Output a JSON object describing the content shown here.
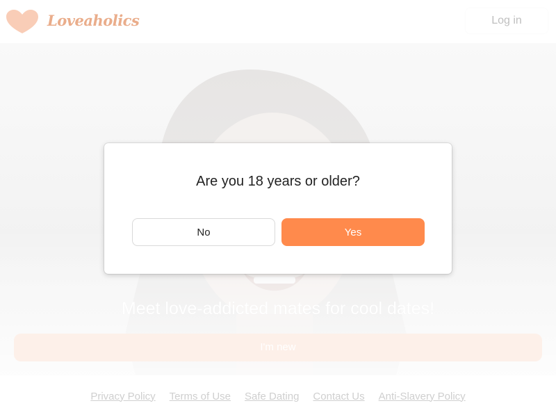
{
  "header": {
    "logo_text": "Loveaholics",
    "login_label": "Log in"
  },
  "hero": {
    "headline": "Meet love-addicted mates for cool dates!",
    "new_button_label": "I'm new"
  },
  "modal": {
    "question": "Are you 18 years or older?",
    "no_label": "No",
    "yes_label": "Yes"
  },
  "footer": {
    "links": [
      "Privacy Policy",
      "Terms of Use",
      "Safe Dating",
      "Contact Us",
      "Anti-Slavery Policy"
    ]
  },
  "colors": {
    "accent": "#ff8a4c",
    "logo": "#f7c2a8"
  }
}
